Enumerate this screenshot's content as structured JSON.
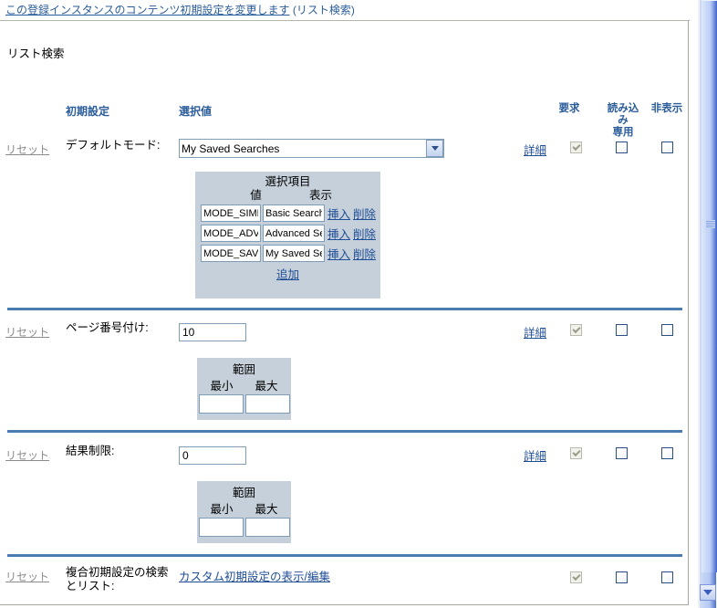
{
  "header": {
    "title_link": "この登録インスタンスのコンテンツ初期設定を変更します",
    "title_suffix": "(リスト検索)"
  },
  "section": {
    "title": "リスト検索"
  },
  "columns": {
    "default_setting": "初期設定",
    "selected_value": "選択値",
    "required": "要求",
    "readonly": "読み込み\nみ\n専用",
    "readonly_line1": "読み込",
    "readonly_line2": "み",
    "readonly_line3": "専用",
    "hidden": "非表示"
  },
  "common": {
    "reset_label": "リセット",
    "detail_label": "詳細",
    "insert_label": "挿入",
    "delete_label": "削除",
    "add_label": "追加"
  },
  "choices_panel": {
    "title": "選択項目",
    "col_value": "値",
    "col_display": "表示",
    "rows": [
      {
        "value": "MODE_SIMPLE",
        "display": "Basic Search"
      },
      {
        "value": "MODE_ADVANCED",
        "display": "Advanced Search"
      },
      {
        "value": "MODE_SAVED",
        "display": "My Saved Searches"
      }
    ]
  },
  "range_panel": {
    "title": "範囲",
    "min_label": "最小",
    "max_label": "最大",
    "min_value": "",
    "max_value": ""
  },
  "rows": [
    {
      "label": "デフォルトモード:",
      "control": "select",
      "value": "My Saved Searches",
      "options": [
        "Basic Search",
        "Advanced Search",
        "My Saved Searches"
      ],
      "required_checked": true,
      "required_disabled": true,
      "readonly_checked": false,
      "hidden_checked": false
    },
    {
      "label": "ページ番号付け:",
      "control": "text",
      "value": "10",
      "required_checked": true,
      "required_disabled": true,
      "readonly_checked": false,
      "hidden_checked": false
    },
    {
      "label": "結果制限:",
      "control": "text",
      "value": "0",
      "required_checked": true,
      "required_disabled": true,
      "readonly_checked": false,
      "hidden_checked": false
    },
    {
      "label": "複合初期設定の検索とリスト:",
      "control": "link",
      "link_text": "カスタム初期設定の表示/編集",
      "required_checked": true,
      "required_disabled": true,
      "readonly_checked": false,
      "hidden_checked": false
    }
  ],
  "colors": {
    "link_blue": "#1f4e96",
    "heading_blue": "#2b5d9b",
    "divider_blue": "#4a7cb0",
    "panel_bg": "#c5d0da",
    "input_border": "#7f9db9"
  }
}
